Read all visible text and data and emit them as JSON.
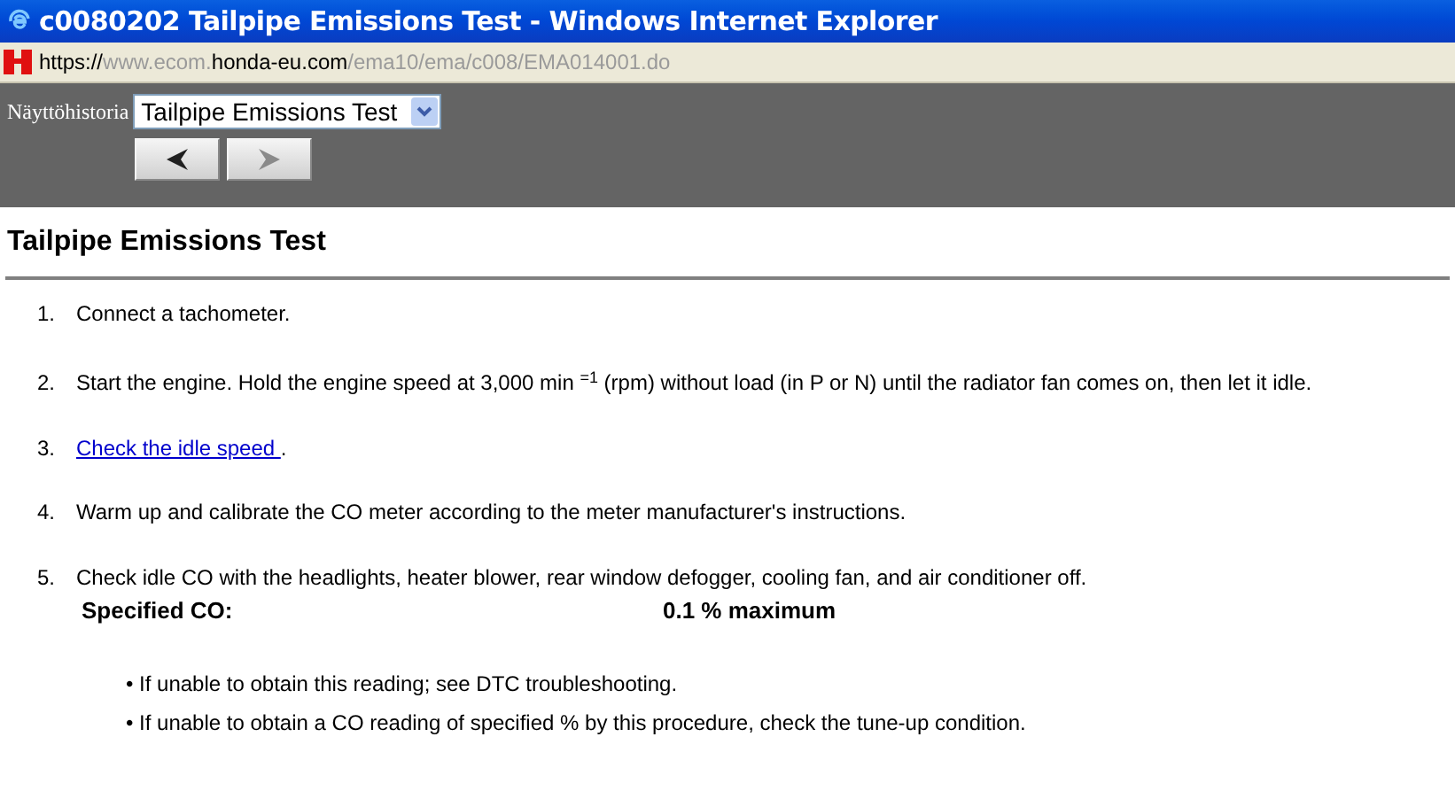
{
  "window": {
    "title": "c0080202 Tailpipe Emissions Test - Windows Internet Explorer"
  },
  "address_bar": {
    "url_parts": [
      {
        "text": "https://",
        "dimmed": false
      },
      {
        "text": "www.ecom.",
        "dimmed": true
      },
      {
        "text": "honda-eu.com",
        "dimmed": false
      },
      {
        "text": "/ema10/ema/c008/EMA014001.do",
        "dimmed": true
      }
    ]
  },
  "toolbar": {
    "history_label": "Näyttöhistoria",
    "history_select": {
      "value": "Tailpipe Emissions Test"
    },
    "nav_buttons": [
      {
        "kind": "back",
        "disabled": false
      },
      {
        "kind": "forward",
        "disabled": true
      }
    ]
  },
  "heading": "Tailpipe Emissions Test",
  "steps": [
    {
      "number": "1.",
      "kind": "text",
      "text": "Connect a tachometer."
    },
    {
      "number": "2.",
      "kind": "text",
      "text": "Start the engine. Hold the engine speed at 3,000 min $^{=1}$ (rpm) without load (in P or N) until the radiator fan comes on, then let it idle."
    },
    {
      "number": "3.",
      "kind": "link",
      "link": "Check the idle speed ",
      "after": "."
    },
    {
      "number": "4.",
      "kind": "text",
      "text": "Warm up and calibrate the CO meter according to the meter manufacturer's instructions."
    },
    {
      "number": "5.",
      "kind": "spec",
      "text": "Check idle CO with the headlights, heater blower, rear window defogger, cooling fan, and air conditioner off.",
      "spec_label": "Specified CO:",
      "spec_value": "0.1 % maximum",
      "notes": [
        "• If unable to obtain this reading; see DTC troubleshooting.",
        "• If unable to obtain a CO reading of specified % by this procedure, check the tune-up condition."
      ]
    }
  ]
}
